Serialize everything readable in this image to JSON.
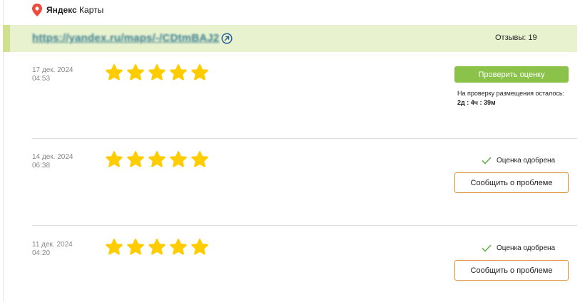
{
  "brand": {
    "name_bold": "Яндекс",
    "name_rest": "Карты",
    "pin_color": "#ef4a3a"
  },
  "header": {
    "link_text": "https://yandex.ru/maps/-/CDtmBAJ2",
    "reviews_label": "Отзывы: 19",
    "background": "#e9f2cf"
  },
  "star_color": "#ffcc00",
  "reviews": [
    {
      "date": "17 дек. 2024",
      "time": "04:53",
      "rating": 5,
      "check_button": "Проверить оценку",
      "remaining_label": "На проверку размещения осталось:",
      "remaining_time": "2д : 4ч : 39м"
    },
    {
      "date": "14 дек. 2024",
      "time": "06:38",
      "rating": 5,
      "status": "Оценка одобрена",
      "report_button": "Сообщить о проблеме"
    },
    {
      "date": "11 дек. 2024",
      "time": "04:20",
      "rating": 5,
      "status": "Оценка одобрена",
      "report_button": "Сообщить о проблеме"
    }
  ]
}
